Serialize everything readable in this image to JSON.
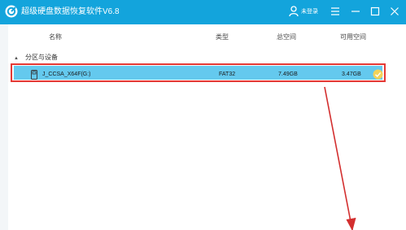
{
  "app": {
    "title": "超级硬盘数据恢复软件V6.8",
    "login_label": "未登录",
    "accent_color": "#13a4dc"
  },
  "window_controls": [
    "menu-icon",
    "minimize-icon",
    "maximize-icon",
    "close-icon"
  ],
  "table": {
    "headers": {
      "name": "名称",
      "type": "类型",
      "total": "总空间",
      "available": "可用空间"
    },
    "group_label": "分区与设备",
    "rows": [
      {
        "name": "J_CCSA_X64F(G:)",
        "type": "FAT32",
        "total": "7.49GB",
        "available": "3.47GB",
        "selected": true,
        "highlight_color": "#e53935",
        "row_color": "#64c9ee"
      }
    ]
  },
  "annotation": {
    "arrow_color": "#d32f2f"
  }
}
